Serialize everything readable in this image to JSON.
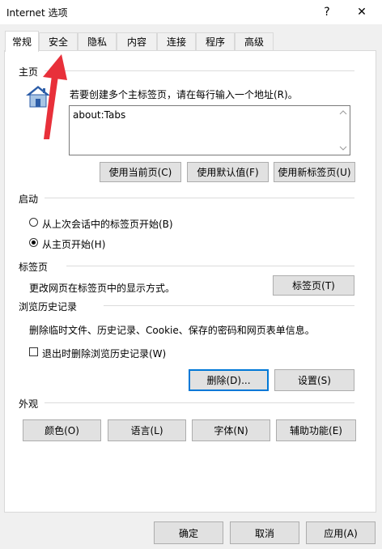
{
  "window": {
    "title": "Internet 选项",
    "help": "?",
    "close": "✕"
  },
  "tabs": [
    "常规",
    "安全",
    "隐私",
    "内容",
    "连接",
    "程序",
    "高级"
  ],
  "home": {
    "label": "主页",
    "instruction": "若要创建多个主标签页，请在每行输入一个地址(R)。",
    "value": "about:Tabs",
    "buttons": [
      "使用当前页(C)",
      "使用默认值(F)",
      "使用新标签页(U)"
    ]
  },
  "startup": {
    "label": "启动",
    "options": [
      "从上次会话中的标签页开始(B)",
      "从主页开始(H)"
    ],
    "selected_index": 1
  },
  "tabs_section": {
    "label": "标签页",
    "desc": "更改网页在标签页中的显示方式。",
    "button": "标签页(T)"
  },
  "history": {
    "label": "浏览历史记录",
    "desc": "删除临时文件、历史记录、Cookie、保存的密码和网页表单信息。",
    "checkbox": "退出时删除浏览历史记录(W)",
    "checked": false,
    "delete_button": "删除(D)...",
    "settings_button": "设置(S)"
  },
  "appearance": {
    "label": "外观",
    "buttons": [
      "颜色(O)",
      "语言(L)",
      "字体(N)",
      "辅助功能(E)"
    ]
  },
  "footer": {
    "ok": "确定",
    "cancel": "取消",
    "apply": "应用(A)"
  },
  "colors": {
    "focus": "#0078d7",
    "arrow": "#e8303a",
    "house_roof": "#2c5da8",
    "house_wall": "#a7c4e4"
  }
}
